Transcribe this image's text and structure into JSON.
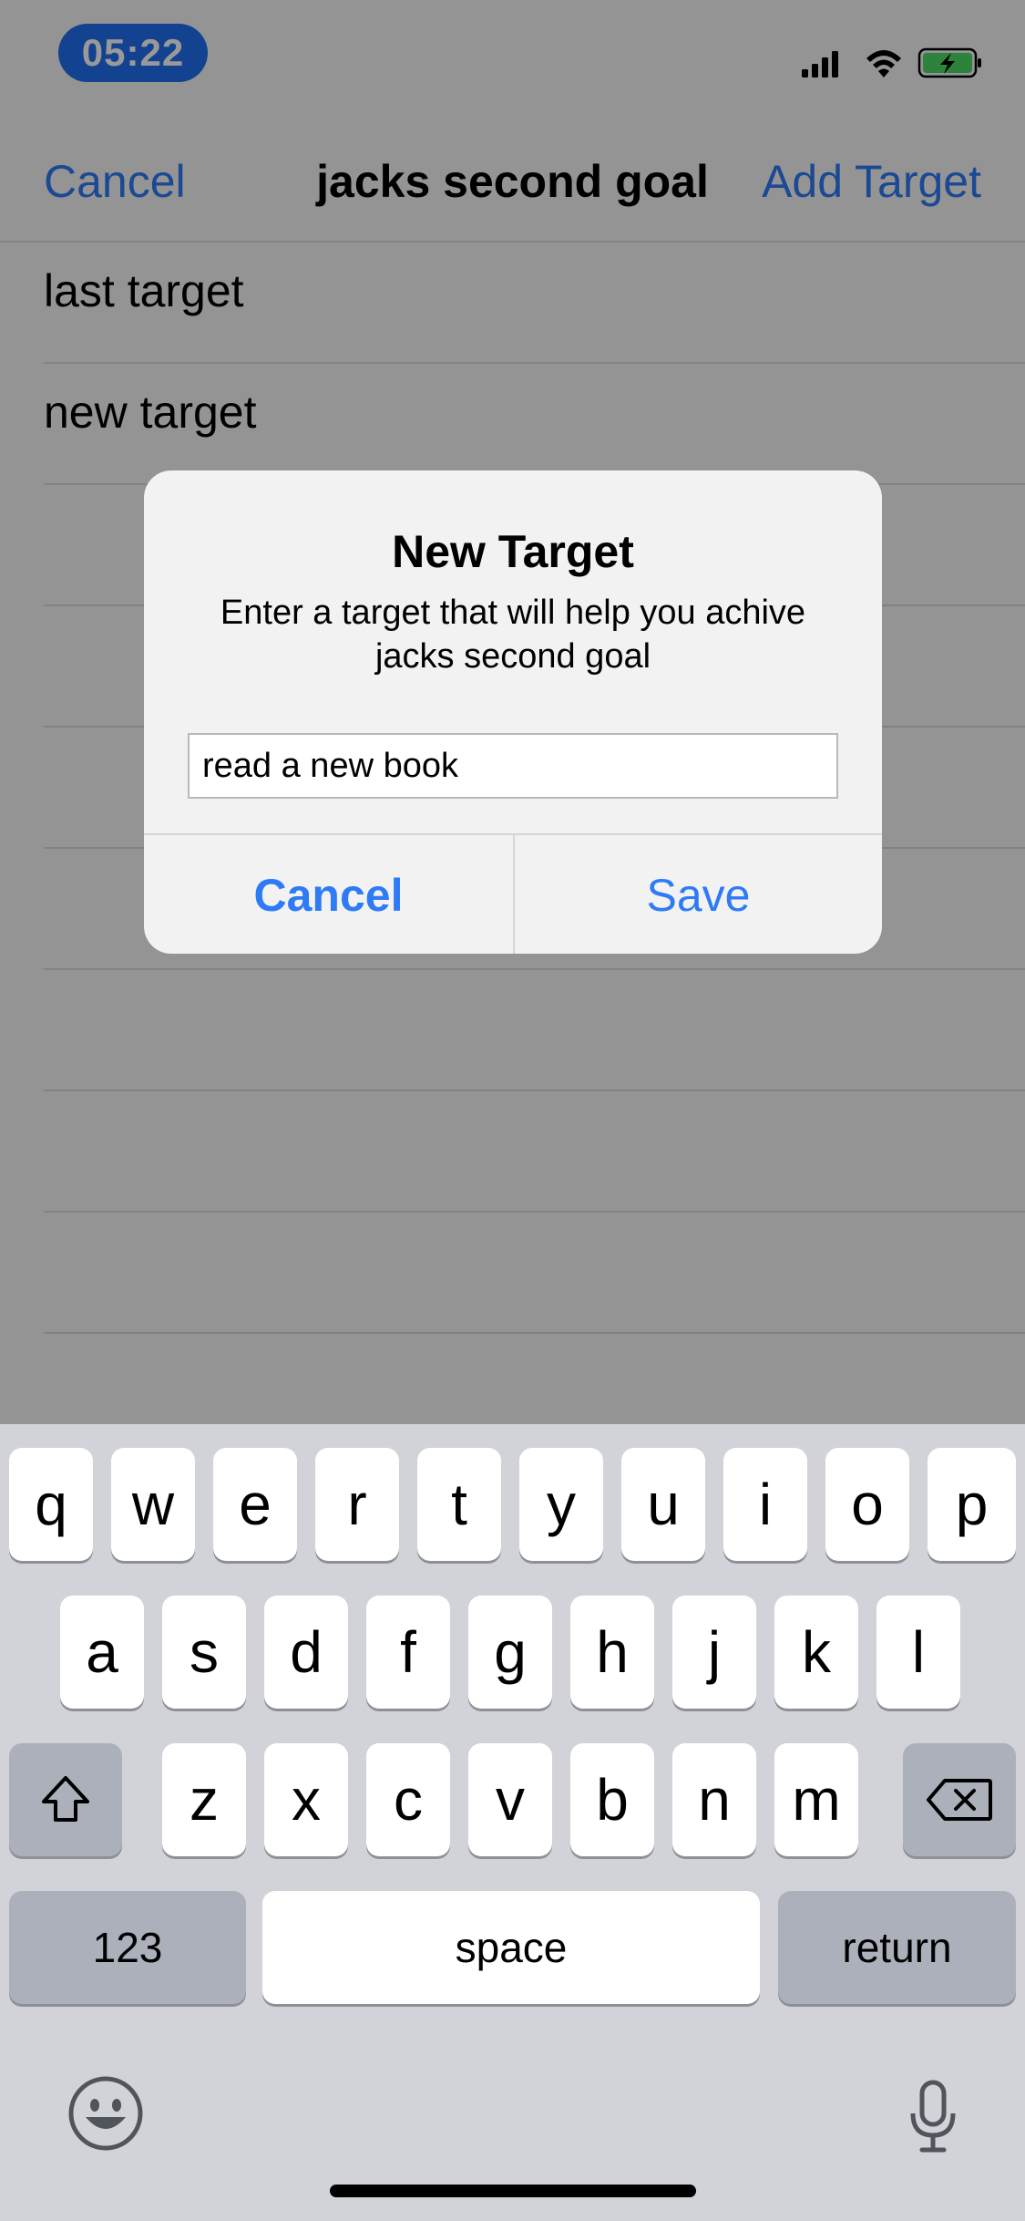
{
  "status_bar": {
    "time": "05:22",
    "icons": [
      "signal-icon",
      "wifi-icon",
      "battery-charging-icon"
    ]
  },
  "nav": {
    "left_label": "Cancel",
    "title": "jacks second goal",
    "right_label": "Add Target"
  },
  "list": {
    "items": [
      {
        "label": "last target"
      },
      {
        "label": "new target"
      },
      {
        "label": ""
      },
      {
        "label": ""
      },
      {
        "label": ""
      },
      {
        "label": ""
      },
      {
        "label": ""
      },
      {
        "label": ""
      },
      {
        "label": ""
      }
    ]
  },
  "alert": {
    "title": "New Target",
    "message": "Enter a target that will help you achive jacks second goal",
    "input_value": "read a new book",
    "cancel_label": "Cancel",
    "save_label": "Save"
  },
  "keyboard": {
    "row1": [
      "q",
      "w",
      "e",
      "r",
      "t",
      "y",
      "u",
      "i",
      "o",
      "p"
    ],
    "row2": [
      "a",
      "s",
      "d",
      "f",
      "g",
      "h",
      "j",
      "k",
      "l"
    ],
    "row3": [
      "z",
      "x",
      "c",
      "v",
      "b",
      "n",
      "m"
    ],
    "numbers_label": "123",
    "space_label": "space",
    "return_label": "return"
  },
  "colors": {
    "accent": "#2f7bf5",
    "time_pill": "#1f6ff0",
    "keyboard_bg": "#d1d3d9"
  }
}
